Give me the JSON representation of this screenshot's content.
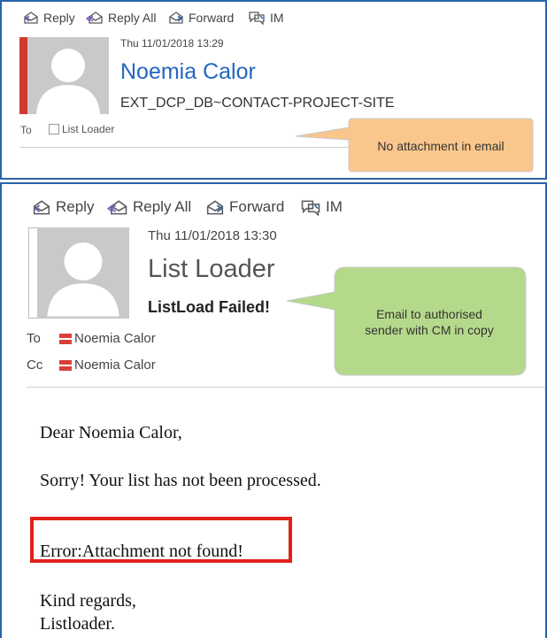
{
  "email1": {
    "toolbar": {
      "reply": "Reply",
      "reply_all": "Reply All",
      "forward": "Forward",
      "im": "IM"
    },
    "datetime": "Thu 11/01/2018 13:29",
    "sender": "Noemia Calor",
    "subject": "EXT_DCP_DB~CONTACT-PROJECT-SITE",
    "to_label": "To",
    "to_recipient": "List Loader"
  },
  "callout1": {
    "text": "No attachment in email",
    "color": "#f9c68b"
  },
  "email2": {
    "toolbar": {
      "reply": "Reply",
      "reply_all": "Reply All",
      "forward": "Forward",
      "im": "IM"
    },
    "datetime": "Thu 11/01/2018 13:30",
    "sender": "List Loader",
    "subject": "ListLoad Failed!",
    "to_label": "To",
    "to_recipient": "Noemia Calor",
    "cc_label": "Cc",
    "cc_recipient": "Noemia Calor",
    "body": {
      "greeting": "Dear Noemia Calor,",
      "message": "Sorry! Your list has not been processed.",
      "error": "Error:Attachment not found!",
      "closing": "Kind regards,",
      "signature": "Listloader."
    }
  },
  "callout2": {
    "line1": "Email to authorised",
    "line2": "sender with CM in copy",
    "color": "#b5d98b"
  },
  "colors": {
    "frame_border": "#2a64a8",
    "sender_link": "#2266c2",
    "error_box": "#e0201c",
    "contact_icon": "#d9403a"
  }
}
